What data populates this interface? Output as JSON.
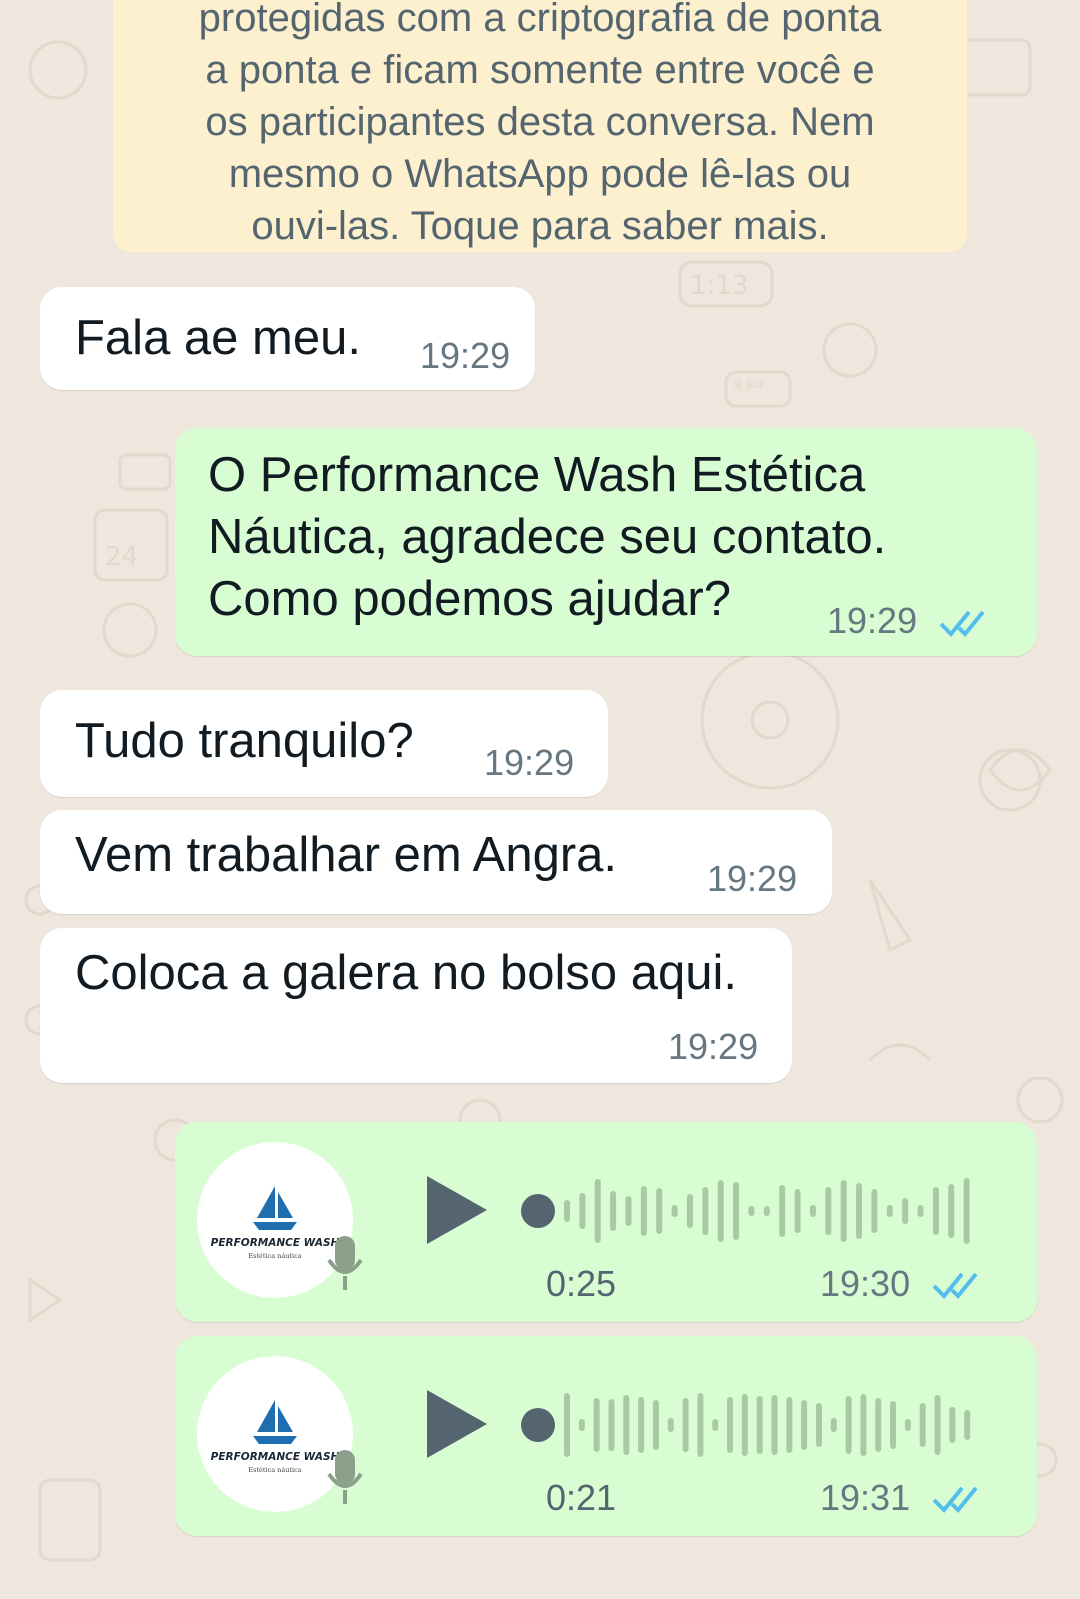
{
  "encryption_notice": {
    "lines": [
      "protegidas com a criptografia de ponta",
      "a ponta e ficam somente entre você e",
      "os participantes desta conversa. Nem",
      "mesmo o WhatsApp pode lê-las ou",
      "ouvi-las. Toque para saber mais."
    ]
  },
  "messages": [
    {
      "direction": "incoming",
      "text": "Fala ae meu.",
      "time": "19:29"
    },
    {
      "direction": "outgoing",
      "lines": [
        "O Performance Wash Estética",
        "Náutica, agradece seu contato.",
        "Como podemos ajudar?"
      ],
      "time": "19:29",
      "status": "read"
    },
    {
      "direction": "incoming",
      "text": "Tudo tranquilo?",
      "time": "19:29"
    },
    {
      "direction": "incoming",
      "text": "Vem trabalhar em Angra.",
      "time": "19:29"
    },
    {
      "direction": "incoming",
      "text": "Coloca a galera no bolso aqui.",
      "time": "19:29"
    }
  ],
  "voice_notes": [
    {
      "duration": "0:25",
      "time": "19:30",
      "status": "read",
      "avatar_brand": "PERFORMANCE WASH",
      "avatar_tagline": "Estética náutica"
    },
    {
      "duration": "0:21",
      "time": "19:31",
      "status": "read",
      "avatar_brand": "PERFORMANCE WASH",
      "avatar_tagline": "Estética náutica"
    }
  ],
  "doodle_text": {
    "clock": "1:13",
    "calendar": "24",
    "password": "***"
  },
  "colors": {
    "wallpaper": "#efe7dd",
    "incoming_bubble": "#ffffff",
    "outgoing_bubble": "#d9fdd3",
    "notice_bubble": "#fdf0cf",
    "read_ticks": "#53bdeb",
    "play_button": "#54656f",
    "wave_unplayed": "#a9c9a4"
  }
}
